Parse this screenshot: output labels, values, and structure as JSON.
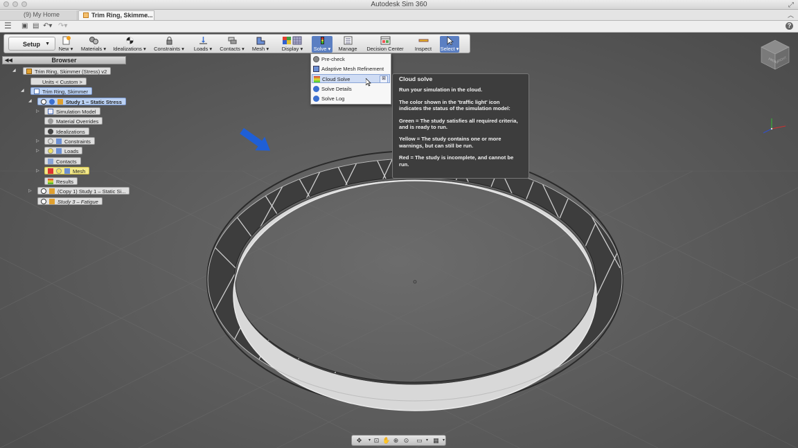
{
  "window": {
    "title": "Autodesk Sim 360"
  },
  "tabs": [
    {
      "label": "(9) My Home"
    },
    {
      "label": "Trim Ring, Skimme...",
      "close": "×"
    }
  ],
  "ribbon": {
    "mode": "Setup",
    "buttons": [
      {
        "label": "New ▾",
        "icon": "new-icon"
      },
      {
        "label": "Materials ▾",
        "icon": "materials-icon"
      },
      {
        "label": "Idealizations ▾",
        "icon": "idealizations-icon"
      },
      {
        "label": "Constraints ▾",
        "icon": "constraints-icon"
      },
      {
        "label": "Loads ▾",
        "icon": "loads-icon"
      },
      {
        "label": "Contacts ▾",
        "icon": "contacts-icon"
      },
      {
        "label": "Mesh ▾",
        "icon": "mesh-icon"
      },
      {
        "label": "Display ▾",
        "icon": "display-icon"
      },
      {
        "label": "Solve ▾",
        "icon": "solve-icon"
      },
      {
        "label": "Manage",
        "icon": "manage-icon"
      },
      {
        "label": "Decision Center",
        "icon": "decision-center-icon"
      },
      {
        "label": "Inspect",
        "icon": "inspect-icon"
      },
      {
        "label": "Select ▾",
        "icon": "select-icon"
      }
    ]
  },
  "browser": {
    "title": "Browser",
    "nodes": [
      {
        "label": "Trim Ring, Skimmer (Stress) v2"
      },
      {
        "label": "Units < Custom >"
      },
      {
        "label": "Trim Ring, Skimmer"
      },
      {
        "label": "Study 1 – Static Stress"
      },
      {
        "label": "Simulation Model"
      },
      {
        "label": "Material Overrides"
      },
      {
        "label": "Idealizations"
      },
      {
        "label": "Constraints"
      },
      {
        "label": "Loads"
      },
      {
        "label": "Contacts"
      },
      {
        "label": "Mesh"
      },
      {
        "label": "Results"
      },
      {
        "label": "(Copy 1) Study 1 – Static Si..."
      },
      {
        "label": "Study 3 – Fatigue"
      }
    ]
  },
  "solve_menu": {
    "items": [
      {
        "label": "Pre-check"
      },
      {
        "label": "Adaptive Mesh Refinement"
      },
      {
        "label": "Cloud Solve"
      },
      {
        "label": "Solve Details"
      },
      {
        "label": "Solve Log"
      }
    ],
    "pin": "⊠"
  },
  "tooltip": {
    "title": "Cloud solve",
    "lines": [
      "Run your simulation in the cloud.",
      "The color shown in the 'traffic light' icon indicates the status of the simulation model:",
      "Green = The study satisfies all required criteria, and is ready to run.",
      "Yellow = The study contains one or more warnings, but can still be run.",
      "Red = The study is incomplete, and cannot be run."
    ]
  },
  "viewcube": {
    "face_top": "FRONT",
    "face_side": "RIGHT"
  },
  "colors": {
    "accent_blue": "#5b7fc2",
    "selection": "#bcd2f3",
    "warning_yellow": "#f3e98a",
    "tooltip_bg": "#3d3d3d",
    "annotation_arrow": "#1f5fd6"
  }
}
